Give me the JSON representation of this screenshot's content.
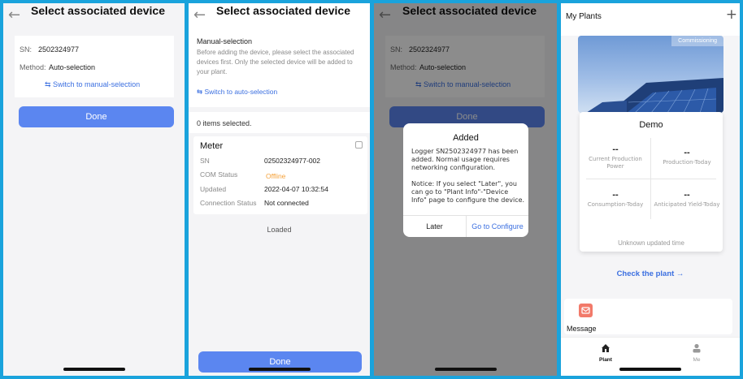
{
  "screens": {
    "auto": {
      "title": "Select associated device",
      "sn_label": "SN:",
      "sn_value": "2502324977",
      "method_label": "Method:",
      "method_value": "Auto-selection",
      "switch_link": "Switch to manual-selection",
      "done": "Done"
    },
    "manual": {
      "title": "Select associated device",
      "heading": "Manual-selection",
      "description": "Before adding the device, please select the associated devices first. Only the selected device will be added to your plant.",
      "switch_link": "Switch to auto-selection",
      "count": "0 items selected.",
      "device": {
        "name": "Meter",
        "sn_label": "SN",
        "sn_value": "02502324977-002",
        "com_label": "COM Status",
        "com_value": "Offline",
        "updated_label": "Updated",
        "updated_value": "2022-04-07 10:32:54",
        "conn_label": "Connection Status",
        "conn_value": "Not connected"
      },
      "loaded": "Loaded",
      "done": "Done"
    },
    "dialog_screen": {
      "title": "Select associated device",
      "sn_label": "SN:",
      "sn_value": "2502324977",
      "method_label": "Method:",
      "method_value": "Auto-selection",
      "switch_link": "Switch to manual-selection",
      "done": "Done",
      "dialog": {
        "title": "Added",
        "message": "Logger SN2502324977 has been added. Normal usage requires networking configuration.",
        "notice": "Notice: If you select \"Later\", you can go to \"Plant Info\"-\"Device Info\" page to configure the device.",
        "later": "Later",
        "configure": "Go to Configure"
      }
    },
    "plants": {
      "title": "My Plants",
      "add_icon": "+",
      "badge": "Commissioning",
      "plant_name": "Demo",
      "stats": [
        {
          "value": "--",
          "label": "Current Production Power"
        },
        {
          "value": "--",
          "label": "Production-Today"
        },
        {
          "value": "--",
          "label": "Consumption-Today"
        },
        {
          "value": "--",
          "label": "Anticipated Yield-Today"
        }
      ],
      "updated": "Unknown updated time",
      "check_link": "Check the plant →",
      "message_label": "Message",
      "nav": [
        {
          "label": "Plant",
          "icon": "home-icon",
          "active": true
        },
        {
          "label": "Me",
          "icon": "person-icon",
          "active": false
        }
      ]
    }
  },
  "colors": {
    "frame": "#1aa3dc",
    "accent": "#5b86f0",
    "link": "#3b6fe0",
    "offline": "#f5a23b",
    "message_icon": "#f27a6a"
  }
}
